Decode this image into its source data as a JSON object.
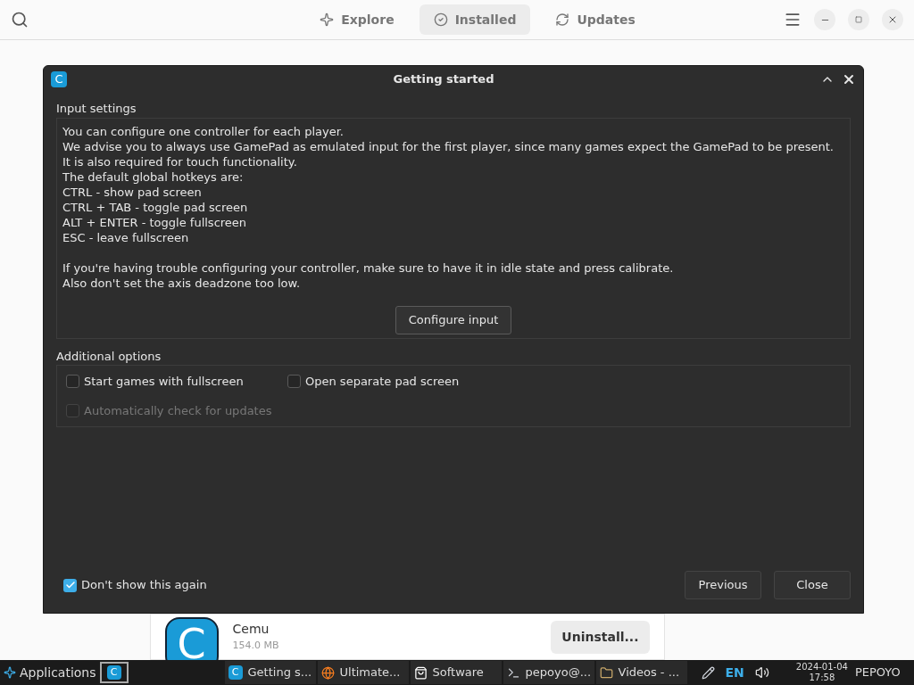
{
  "app_header": {
    "tabs": [
      {
        "label": "Explore",
        "selected": false,
        "kind": "explore"
      },
      {
        "label": "Installed",
        "selected": true,
        "kind": "installed"
      },
      {
        "label": "Updates",
        "selected": false,
        "kind": "updates"
      }
    ]
  },
  "installed_app": {
    "icon_letter": "C",
    "name": "Cemu",
    "size": "154.0 MB",
    "action": "Uninstall..."
  },
  "dialog": {
    "icon_letter": "C",
    "title": "Getting started",
    "input_settings": {
      "title": "Input settings",
      "paragraphs": [
        [
          "You can configure one controller for each player.",
          "We advise you to always use GamePad as emulated input for the first player, since many games expect the GamePad to be present.",
          "It is also required for touch functionality.",
          "The default global hotkeys are:",
          "CTRL - show pad screen",
          "CTRL + TAB - toggle pad screen",
          "ALT + ENTER - toggle fullscreen",
          "ESC - leave fullscreen"
        ],
        [
          "If you're having trouble configuring your controller, make sure to have it in idle state and press calibrate.",
          "Also don't set the axis deadzone too low."
        ]
      ],
      "button": "Configure input"
    },
    "additional_options": {
      "title": "Additional options",
      "options": [
        {
          "label": "Start games with fullscreen",
          "checked": false,
          "disabled": false
        },
        {
          "label": "Open separate pad screen",
          "checked": false,
          "disabled": false
        },
        {
          "label": "Automatically check for updates",
          "checked": false,
          "disabled": true
        }
      ]
    },
    "dont_show_again": {
      "label": "Don't show this again",
      "checked": true
    },
    "buttons": [
      "Previous",
      "Close"
    ]
  },
  "taskbar": {
    "start": "Applications",
    "launcher_letter": "C",
    "tasks": [
      {
        "label": "Getting s...",
        "kind": "cemu",
        "icon_letter": "C"
      },
      {
        "label": "Ultimate...",
        "kind": "browser"
      },
      {
        "label": "Software",
        "kind": "store"
      },
      {
        "label": "pepoyo@...",
        "kind": "terminal"
      },
      {
        "label": "Videos - ...",
        "kind": "folder"
      }
    ],
    "keyboard": "EN",
    "date": "2024-01-04",
    "time": "17:58",
    "user": "PEPOYO"
  }
}
